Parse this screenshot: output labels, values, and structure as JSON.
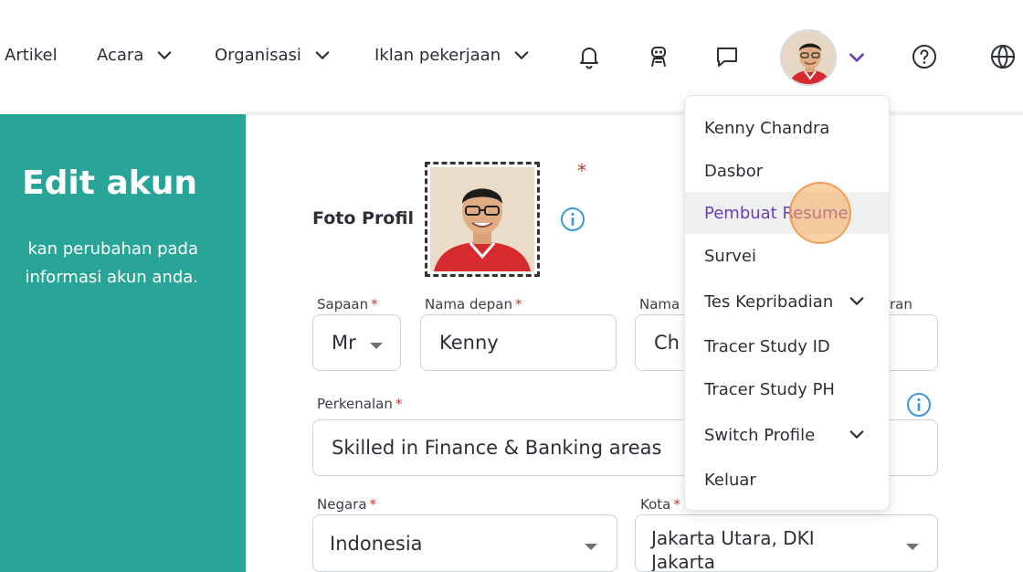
{
  "nav": {
    "items": [
      {
        "label": "Artikel"
      },
      {
        "label": "Acara"
      },
      {
        "label": "Organisasi"
      },
      {
        "label": "Iklan pekerjaan"
      }
    ]
  },
  "left_panel": {
    "title": "Edit akun",
    "desc_line1": "kan perubahan pada",
    "desc_line2": "informasi akun anda."
  },
  "form": {
    "photo_label": "Foto Profil",
    "required_mark": "*",
    "salutation_label": "Sapaan",
    "salutation_value": "Mr",
    "first_name_label": "Nama depan",
    "first_name_value": "Kenny",
    "last_name_label_visible": "Nama",
    "last_name_value_visible": "Ch",
    "third_label_visible": "ran",
    "intro_label": "Perkenalan",
    "intro_value": "Skilled in Finance & Banking areas",
    "country_label": "Negara",
    "country_value": "Indonesia",
    "city_label": "Kota",
    "city_value_line1": "Jakarta Utara, DKI",
    "city_value_line2": "Jakarta"
  },
  "menu": {
    "items": [
      {
        "label": "Kenny Chandra"
      },
      {
        "label": "Dasbor"
      },
      {
        "label": "Pembuat Resume"
      },
      {
        "label": "Survei"
      },
      {
        "label": "Tes Kepribadian"
      },
      {
        "label": "Tracer Study ID"
      },
      {
        "label": "Tracer Study PH"
      },
      {
        "label": "Switch Profile"
      },
      {
        "label": "Keluar"
      }
    ]
  },
  "colors": {
    "teal_panel": "#28a597",
    "active_menu_text": "#6c3fb5",
    "required": "#c0392b",
    "info": "#3a9ad9"
  }
}
